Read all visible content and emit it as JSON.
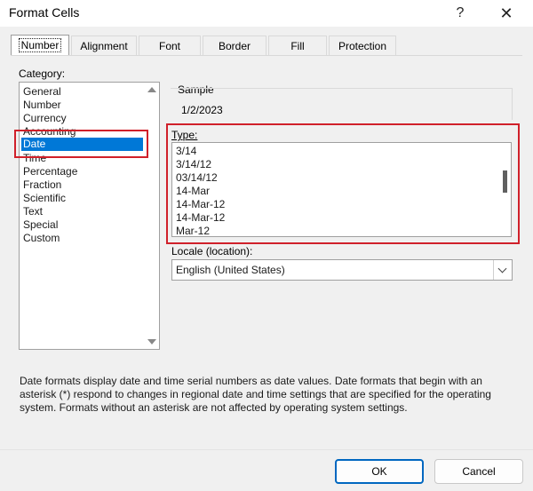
{
  "window": {
    "title": "Format Cells",
    "help_glyph": "?",
    "close_glyph": "✕"
  },
  "tabs": [
    {
      "label": "Number",
      "active": true
    },
    {
      "label": "Alignment",
      "active": false
    },
    {
      "label": "Font",
      "active": false
    },
    {
      "label": "Border",
      "active": false
    },
    {
      "label": "Fill",
      "active": false
    },
    {
      "label": "Protection",
      "active": false
    }
  ],
  "category": {
    "label": "Category:",
    "items": [
      "General",
      "Number",
      "Currency",
      "Accounting",
      "Date",
      "Time",
      "Percentage",
      "Fraction",
      "Scientific",
      "Text",
      "Special",
      "Custom"
    ],
    "selected": "Date"
  },
  "sample": {
    "label": "Sample",
    "value": "1/2/2023"
  },
  "type": {
    "label": "Type:",
    "items": [
      "3/14",
      "3/14/12",
      "03/14/12",
      "14-Mar",
      "14-Mar-12",
      "14-Mar-12",
      "Mar-12"
    ]
  },
  "locale": {
    "label": "Locale (location):",
    "value": "English (United States)"
  },
  "description": "Date formats display date and time serial numbers as date values.  Date formats that begin with an asterisk (*) respond to changes in regional date and time settings that are specified for the operating system. Formats without an asterisk are not affected by operating system settings.",
  "buttons": {
    "ok": "OK",
    "cancel": "Cancel"
  },
  "colors": {
    "selection": "#0078d7",
    "highlight_box": "#d0202a",
    "default_button_border": "#0067c0"
  },
  "icons": {
    "close": "close-icon",
    "help": "help-icon",
    "scroll_up": "scroll-up-arrow-icon",
    "scroll_down": "scroll-down-arrow-icon",
    "dropdown": "chevron-down-icon"
  }
}
